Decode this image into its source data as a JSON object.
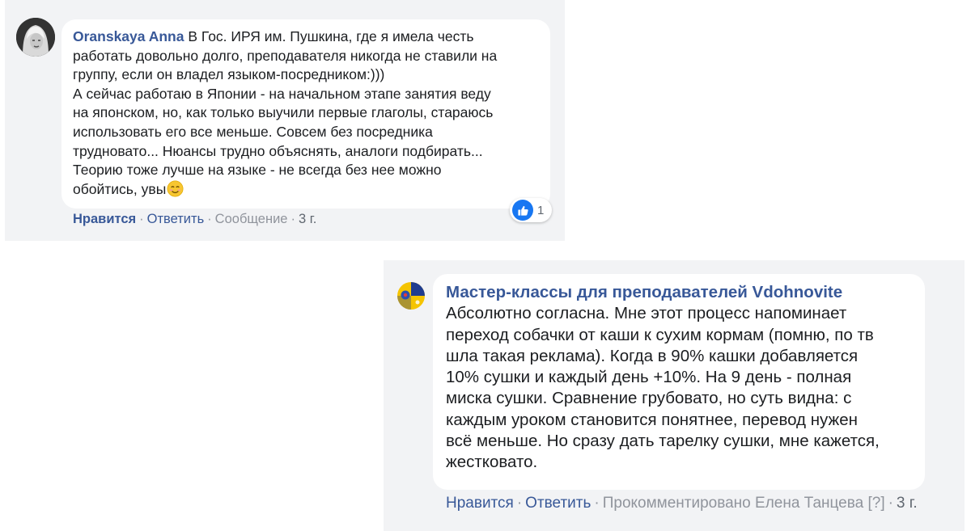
{
  "comments": [
    {
      "author": "Oranskaya Anna",
      "text": "В Гос. ИРЯ им. Пушкина, где я имела честь\nработать довольно долго, преподавателя никогда не ставили на\nгруппу, если он владел языком-посредником:)))\nА сейчас работаю в Японии - на начальном этапе занятия веду\nна японском, но, как только выучили первые глаголы, стараюсь\nиспользовать его все меньше. Совсем без посредника\nтрудновато... Нюансы трудно объяснять, аналоги подбирать...\nТеорию тоже лучше на языке - не всегда без нее можно\nобойтись, увы",
      "emoji": "smiling-face-emoji",
      "actions": {
        "like": "Нравится",
        "reply": "Ответить",
        "message": "Сообщение",
        "time": "3 г."
      },
      "reactions": {
        "icon": "thumbs-up-icon",
        "count": "1",
        "color": "#1877f2"
      }
    },
    {
      "author": "Мастер-классы для преподавателей Vdohnovite",
      "text": "Абсолютно согласна. Мне этот процесс напоминает\nпереход собачки от каши к сухим кормам (помню, по тв\nшла такая реклама). Когда в 90% кашки добавляется\n10% сушки и каждый день +10%. На 9 день - полная\nмиска сушки. Сравнение грубовато, но суть видна: с\nкаждым уроком становится понятнее, перевод нужен\nвсё меньше. Но сразу дать тарелку сушки, мне кажется,\nжестковато.",
      "actions": {
        "like": "Нравится",
        "reply": "Ответить",
        "commented_by": "Прокомментировано Елена Танцева",
        "help": "[?]",
        "time": "3 г."
      }
    }
  ],
  "colors": {
    "link": "#385898",
    "panel_background": "#f2f3f5",
    "bubble_background": "#ffffff",
    "muted_text": "#90949c"
  }
}
